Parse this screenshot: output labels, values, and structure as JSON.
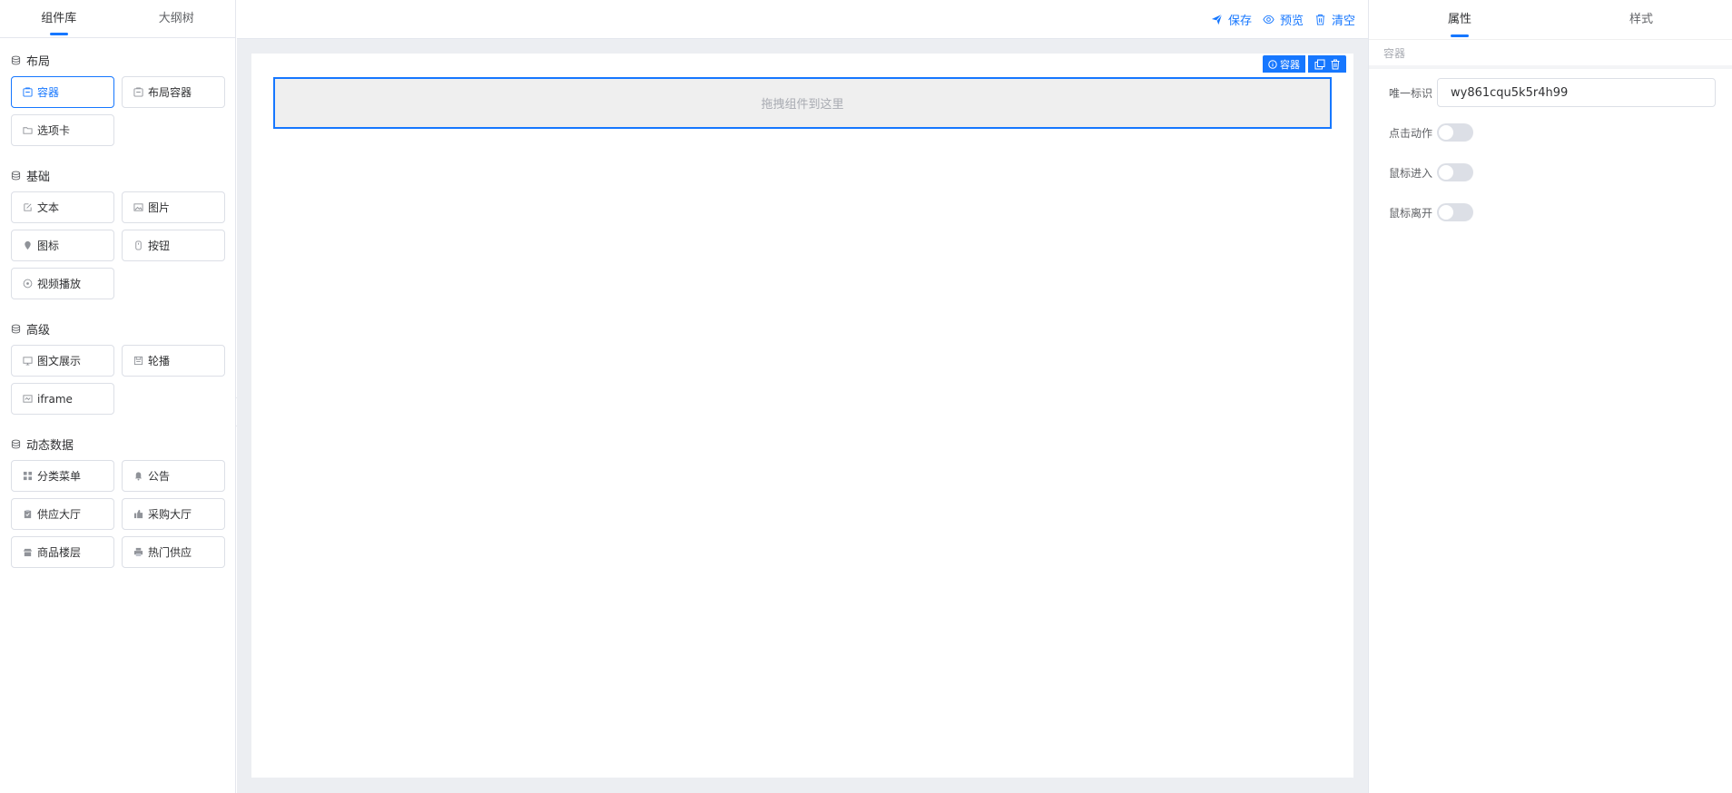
{
  "left_panel": {
    "tabs": [
      {
        "label": "组件库",
        "active": true
      },
      {
        "label": "大纲树",
        "active": false
      }
    ],
    "groups": [
      {
        "title": "布局",
        "items": [
          {
            "label": "容器",
            "icon": "container-icon",
            "active": true
          },
          {
            "label": "布局容器",
            "icon": "layout-container-icon"
          },
          {
            "label": "选项卡",
            "icon": "folder-icon"
          }
        ]
      },
      {
        "title": "基础",
        "items": [
          {
            "label": "文本",
            "icon": "edit-icon"
          },
          {
            "label": "图片",
            "icon": "image-icon"
          },
          {
            "label": "图标",
            "icon": "pin-icon"
          },
          {
            "label": "按钮",
            "icon": "button-icon"
          },
          {
            "label": "视频播放",
            "icon": "play-icon"
          }
        ]
      },
      {
        "title": "高级",
        "items": [
          {
            "label": "图文展示",
            "icon": "media-icon"
          },
          {
            "label": "轮播",
            "icon": "carousel-icon"
          },
          {
            "label": "iframe",
            "icon": "frame-icon"
          }
        ]
      },
      {
        "title": "动态数据",
        "items": [
          {
            "label": "分类菜单",
            "icon": "grid-icon"
          },
          {
            "label": "公告",
            "icon": "bell-icon"
          },
          {
            "label": "供应大厅",
            "icon": "clipboard-icon"
          },
          {
            "label": "采购大厅",
            "icon": "thumb-icon"
          },
          {
            "label": "商品楼层",
            "icon": "shop-icon"
          },
          {
            "label": "热门供应",
            "icon": "printer-icon"
          }
        ]
      }
    ]
  },
  "toolbar": {
    "save_label": "保存",
    "preview_label": "预览",
    "clear_label": "清空"
  },
  "canvas": {
    "dropzone_text": "拖拽组件到这里",
    "selected_label": "容器"
  },
  "right_panel": {
    "tabs": [
      {
        "label": "属性",
        "active": true
      },
      {
        "label": "样式",
        "active": false
      }
    ],
    "breadcrumb": "容器",
    "fields": {
      "id_label": "唯一标识",
      "id_value": "wy861cqu5k5r4h99",
      "click_label": "点击动作",
      "click_on": false,
      "enter_label": "鼠标进入",
      "enter_on": false,
      "leave_label": "鼠标离开",
      "leave_on": false
    }
  },
  "colors": {
    "accent": "#1677ff",
    "border": "#dcdfe6",
    "canvas_bg": "#eceef2"
  }
}
